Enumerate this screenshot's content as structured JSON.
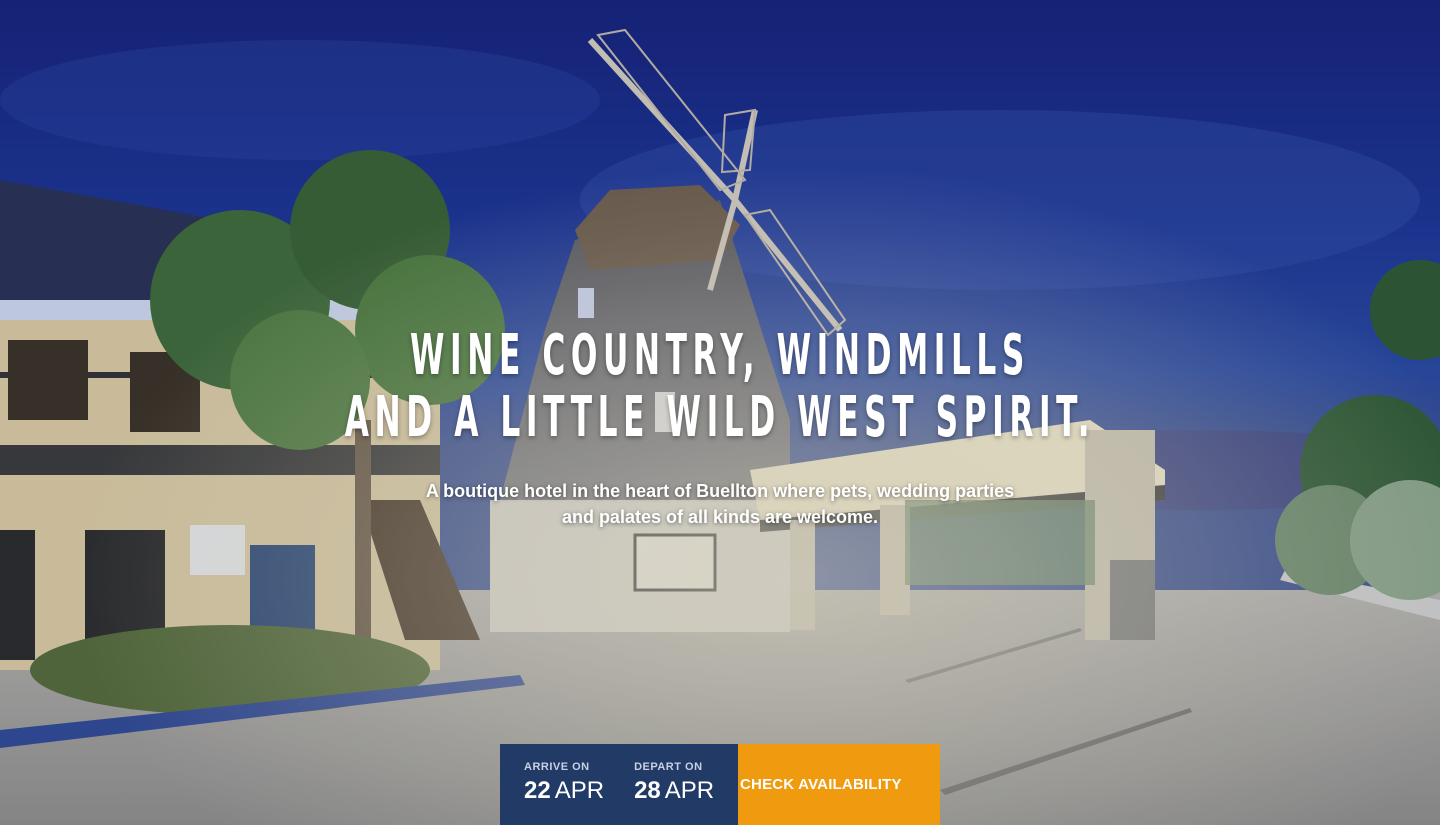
{
  "hero": {
    "headline_line1": "WINE COUNTRY, WINDMILLS",
    "headline_line2": "AND A LITTLE WILD WEST SPIRIT.",
    "subtitle_line1": "A boutique hotel in the heart of Buellton where pets, wedding parties",
    "subtitle_line2": "and palates of all kinds are welcome."
  },
  "booking": {
    "arrive_label": "ARRIVE ON",
    "arrive_day": "22",
    "arrive_month": "APR",
    "depart_label": "DEPART ON",
    "depart_day": "28",
    "depart_month": "APR",
    "cta_label": "CHECK AVAILABILITY"
  },
  "colors": {
    "booking_bg": "#213a66",
    "cta_bg": "#f09a10",
    "sky": "#1b2f86"
  }
}
